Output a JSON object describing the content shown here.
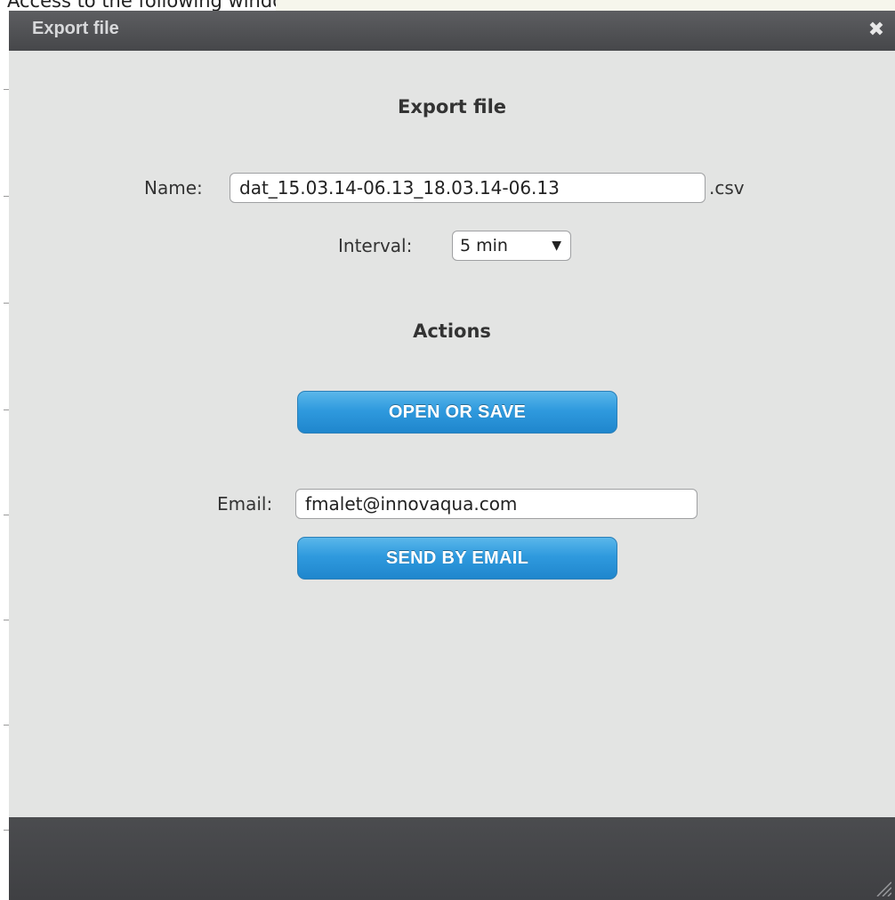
{
  "page": {
    "caption": "Access to the following window:"
  },
  "dialog": {
    "title": "Export file",
    "close_icon": "close-icon"
  },
  "export": {
    "heading": "Export file",
    "name_label": "Name:",
    "name_value": "dat_15.03.14-06.13_18.03.14-06.13",
    "extension": ".csv",
    "interval_label": "Interval:",
    "interval_value": "5 min",
    "dropdown_icon": "triangle-down-icon"
  },
  "actions": {
    "heading": "Actions",
    "open_save_label": "OPEN OR SAVE",
    "email_label": "Email:",
    "email_value": "fmalet@innovaqua.com",
    "send_email_label": "SEND BY EMAIL"
  },
  "colors": {
    "titlebar": "#4f5053",
    "dialog_bg": "#e3e4e3",
    "button": "#2f9ade",
    "footer": "#444548"
  }
}
